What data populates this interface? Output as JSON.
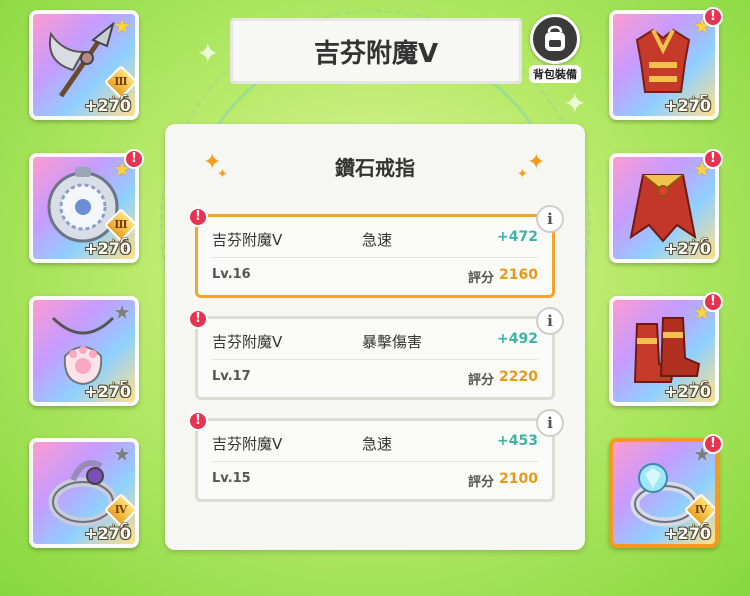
{
  "header": {
    "title": "吉芬附魔Ⅴ",
    "bag_button_label": "背包裝備"
  },
  "panel": {
    "title": "鑽石戒指",
    "cards": [
      {
        "name": "吉芬附魔Ⅴ",
        "stat": "急速",
        "value": "+472",
        "level": "Lv.16",
        "score_label": "評分",
        "score": "2160",
        "selected": true
      },
      {
        "name": "吉芬附魔Ⅴ",
        "stat": "暴擊傷害",
        "value": "+492",
        "level": "Lv.17",
        "score_label": "評分",
        "score": "2220",
        "selected": false
      },
      {
        "name": "吉芬附魔Ⅴ",
        "stat": "急速",
        "value": "+453",
        "level": "Lv.15",
        "score_label": "評分",
        "score": "2100",
        "selected": false
      }
    ]
  },
  "slots_left": [
    {
      "name": "scythe-spear",
      "rank": "Ⅲ",
      "plus": "+6",
      "power": "+270",
      "star": "gold",
      "alert": false
    },
    {
      "name": "silver-plate-medallion",
      "rank": "Ⅲ",
      "plus": "+6",
      "power": "+270",
      "star": "gold",
      "alert": true
    },
    {
      "name": "paw-pendant-necklace",
      "rank": "",
      "plus": "+5",
      "power": "+270",
      "star": "grey",
      "alert": false
    },
    {
      "name": "silver-ring",
      "rank": "Ⅳ",
      "plus": "+6",
      "power": "+270",
      "star": "grey",
      "alert": false
    }
  ],
  "slots_right": [
    {
      "name": "red-gold-armor",
      "rank": "",
      "plus": "+5",
      "power": "+270",
      "star": "gold",
      "alert": true
    },
    {
      "name": "red-gold-cape",
      "rank": "",
      "plus": "+6",
      "power": "+270",
      "star": "gold",
      "alert": true
    },
    {
      "name": "red-gold-boots",
      "rank": "",
      "plus": "+6",
      "power": "+270",
      "star": "gold",
      "alert": true
    },
    {
      "name": "diamond-ring",
      "rank": "Ⅳ",
      "plus": "+6",
      "power": "+270",
      "star": "grey",
      "alert": true,
      "selected": true
    }
  ],
  "icons": {
    "alert": "!",
    "info": "i",
    "star": "★",
    "sparkle": "✦"
  },
  "colors": {
    "accent": "#f59a1f",
    "stat_value": "#3fb3a5",
    "score": "#e79a16",
    "alert": "#e8324f"
  }
}
